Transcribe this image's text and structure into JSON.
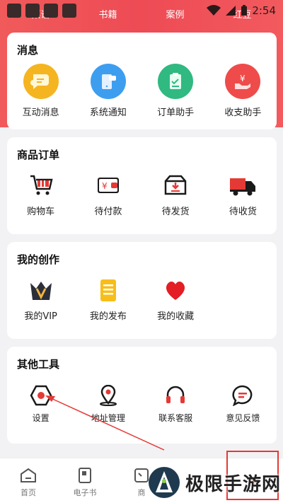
{
  "status_bar": {
    "time": "2:54"
  },
  "stats": [
    {
      "label": "菜谱"
    },
    {
      "label": "书籍"
    },
    {
      "label": "案例"
    },
    {
      "label": "红豆"
    }
  ],
  "messages": {
    "title": "消息",
    "items": [
      {
        "label": "互动消息",
        "icon": "chat-bubble-icon",
        "color": "#f5b521"
      },
      {
        "label": "系统通知",
        "icon": "phone-notification-icon",
        "color": "#3d9ef0"
      },
      {
        "label": "订单助手",
        "icon": "clipboard-icon",
        "color": "#30b980"
      },
      {
        "label": "收支助手",
        "icon": "yuan-hand-icon",
        "color": "#ef4b4b"
      }
    ]
  },
  "orders": {
    "title": "商品订单",
    "items": [
      {
        "label": "购物车",
        "icon": "cart-icon"
      },
      {
        "label": "待付款",
        "icon": "wallet-icon"
      },
      {
        "label": "待发货",
        "icon": "package-icon"
      },
      {
        "label": "待收货",
        "icon": "truck-icon"
      }
    ]
  },
  "creation": {
    "title": "我的创作",
    "items": [
      {
        "label": "我的VIP",
        "icon": "vip-crown-icon"
      },
      {
        "label": "我的发布",
        "icon": "document-icon"
      },
      {
        "label": "我的收藏",
        "icon": "heart-icon"
      }
    ]
  },
  "tools": {
    "title": "其他工具",
    "items": [
      {
        "label": "设置",
        "icon": "gear-icon"
      },
      {
        "label": "地址管理",
        "icon": "location-pin-icon"
      },
      {
        "label": "联系客服",
        "icon": "headset-icon"
      },
      {
        "label": "意见反馈",
        "icon": "feedback-icon"
      }
    ]
  },
  "bottom_nav": [
    {
      "label": "首页",
      "icon": "home-icon"
    },
    {
      "label": "电子书",
      "icon": "ebook-icon"
    },
    {
      "label": "商",
      "icon": "shop-icon"
    },
    {
      "label": "",
      "icon": "blank-icon"
    },
    {
      "label": "",
      "icon": "profile-icon"
    }
  ],
  "watermark": {
    "text": "极限手游网"
  },
  "colors": {
    "accent": "#ee4b55",
    "tool_icon": "#e53935"
  }
}
